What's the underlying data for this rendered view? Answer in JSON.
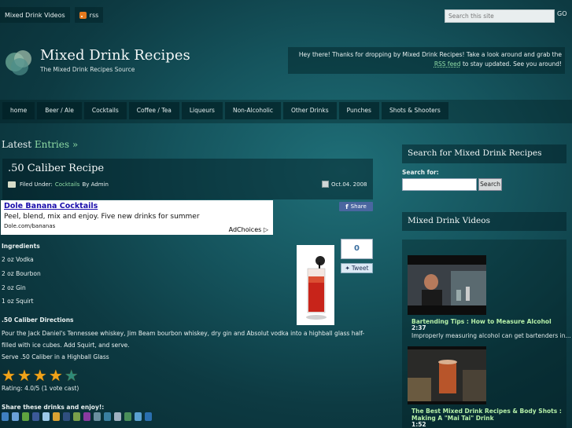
{
  "topbar": {
    "videos_label": "Mixed Drink Videos",
    "rss_label": "rss",
    "search_placeholder": "Search this site",
    "go_label": "GO"
  },
  "header": {
    "site_title": "Mixed Drink Recipes",
    "site_subtitle": "The Mixed Drink Recipes Source",
    "welcome_before": "Hey there! Thanks for dropping by Mixed Drink Recipes! Take a look around and grab the ",
    "welcome_rss": "RSS feed",
    "welcome_after": " to stay updated. See you around!"
  },
  "nav": {
    "items": [
      "home",
      "Beer / Ale",
      "Cocktails",
      "Coffee / Tea",
      "Liqueurs",
      "Non-Alcoholic",
      "Other Drinks",
      "Punches",
      "Shots & Shooters"
    ]
  },
  "main": {
    "latest_prefix": "Latest",
    "latest_entries": "Entries »",
    "post": {
      "title": ".50 Caliber Recipe",
      "filed_under": "Filed Under:",
      "category": "Cocktails",
      "by": "By Admin",
      "date": "Oct.04. 2008",
      "share_label": "Share",
      "vote_count": "0",
      "tweet_label": "Tweet",
      "ingredients_heading": "Ingredients",
      "ingredients": [
        "2 oz Vodka",
        "2 oz Bourbon",
        "2 oz Gin",
        "1 oz Squirt"
      ],
      "directions_heading": ".50 Caliber Directions",
      "directions": "Pour the Jack Daniel's Tennessee whiskey, Jim Beam bourbon whiskey, dry gin and Absolut vodka into a highball glass half-filled with ice cubes. Add Squirt, and serve.",
      "serve": "Serve .50 Caliber in a Highball Glass",
      "rating_stars": 4,
      "rating_max": 5,
      "rating_text": "Rating: 4.0/5 (1 vote cast)",
      "share_heading": "Share these drinks and enjoy!:"
    },
    "ad": {
      "title": "Dole Banana Cocktails",
      "text": "Peel, blend, mix and enjoy. Five new drinks for summer",
      "url": "Dole.com/bananas",
      "choices": "AdChoices"
    }
  },
  "sidebar": {
    "search_title": "Search for Mixed Drink Recipes",
    "search_for_label": "Search for:",
    "search_button": "Search",
    "videos_title": "Mixed Drink Videos",
    "videos": [
      {
        "title": "Bartending Tips : How to Measure Alcohol",
        "duration": "2:37",
        "desc": "Improperly measuring alcohol can get bartenders in..."
      },
      {
        "title": "The Best Mixed Drink Recipes & Body Shots : Making A \"Mai Tai\" Drink",
        "duration": "1:52",
        "desc": ""
      }
    ]
  },
  "colors": {
    "accent_green": "#8fdca5",
    "star": "#f0a31a",
    "facebook": "#4a66a0"
  },
  "icons": {
    "share_icons": [
      "digg-icon",
      "delicious-icon",
      "stumbleupon-icon",
      "facebook-icon",
      "reddit-icon",
      "google-icon",
      "myspace-icon",
      "technorati-icon",
      "yahoo-icon",
      "furl-icon",
      "blinklist-icon",
      "email-icon",
      "newsvine-icon",
      "twitter-icon",
      "live-icon"
    ]
  }
}
